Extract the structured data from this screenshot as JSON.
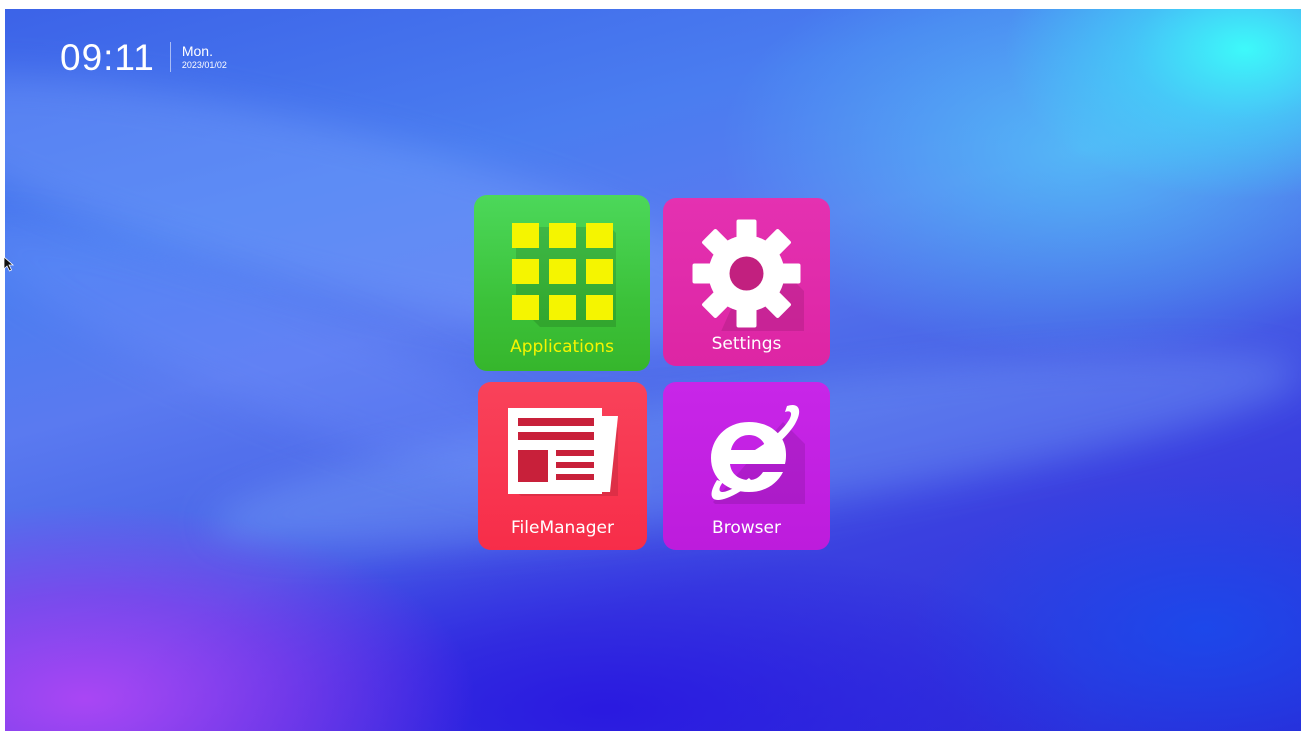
{
  "status_bar": {
    "time": "09:11",
    "day": "Mon.",
    "date": "2023/01/02"
  },
  "launcher": {
    "tiles": [
      {
        "label": "Applications",
        "icon": "apps-grid-icon",
        "color": "#3fc63a",
        "label_color": "#f5f500"
      },
      {
        "label": "Settings",
        "icon": "gear-icon",
        "color": "#e02aa8",
        "label_color": "#ffffff"
      },
      {
        "label": "FileManager",
        "icon": "news-document-icon",
        "color": "#f9304f",
        "label_color": "#ffffff"
      },
      {
        "label": "Browser",
        "icon": "internet-explorer-icon",
        "color": "#c21fe2",
        "label_color": "#ffffff"
      }
    ]
  },
  "colors": {
    "apps_grid": "#f5f500",
    "settings_gear": "#ffffff",
    "file_doc": "#ffffff",
    "browser_logo": "#ffffff"
  }
}
